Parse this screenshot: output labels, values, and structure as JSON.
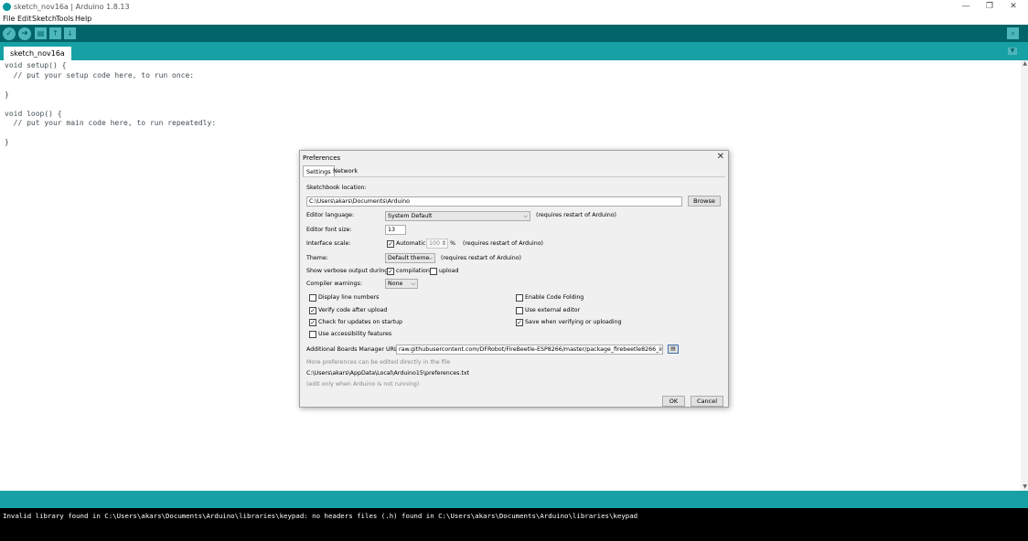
{
  "window": {
    "title": "sketch_nov16a | Arduino 1.8.13",
    "minimize": "—",
    "restore": "❐",
    "close": "✕"
  },
  "menu": [
    "File",
    "Edit",
    "Sketch",
    "Tools",
    "Help"
  ],
  "toolbar": {
    "verify_icon": "✓",
    "upload_icon": "➜",
    "new_icon": "▤",
    "open_icon": "↑",
    "save_icon": "↓",
    "serial_monitor_icon": "⌕"
  },
  "tab": {
    "name": "sketch_nov16a",
    "menu_icon": "▼"
  },
  "code": [
    "void setup() {",
    "  // put your setup code here, to run once:",
    "",
    "}",
    "",
    "void loop() {",
    "  // put your main code here, to run repeatedly:",
    "",
    "}"
  ],
  "scrollbar": {
    "up": "▲",
    "down": "▼"
  },
  "console": {
    "message": "Invalid library found in C:\\Users\\akars\\Documents\\Arduino\\libraries\\keypad: no headers files (.h) found in C:\\Users\\akars\\Documents\\Arduino\\libraries\\keypad"
  },
  "preferences": {
    "title": "Preferences",
    "close": "✕",
    "tabs": [
      "Settings",
      "Network"
    ],
    "sketchbook_label": "Sketchbook location:",
    "sketchbook_path": "C:\\Users\\akars\\Documents\\Arduino",
    "browse": "Browse",
    "editor_language_label": "Editor language:",
    "editor_language_value": "System Default",
    "editor_language_note": "(requires restart of Arduino)",
    "font_size_label": "Editor font size:",
    "font_size_value": "13",
    "interface_scale_label": "Interface scale:",
    "interface_scale_auto": "Automatic",
    "interface_scale_value": "100",
    "interface_scale_unit": "%",
    "interface_scale_note": "(requires restart of Arduino)",
    "theme_label": "Theme:",
    "theme_value": "Default theme",
    "theme_note": "(requires restart of Arduino)",
    "verbose_label": "Show verbose output during:",
    "verbose_compilation": "compilation",
    "verbose_upload": "upload",
    "warnings_label": "Compiler warnings:",
    "warnings_value": "None",
    "checkboxes_left": [
      {
        "label": "Display line numbers",
        "checked": false
      },
      {
        "label": "Verify code after upload",
        "checked": true
      },
      {
        "label": "Check for updates on startup",
        "checked": true
      },
      {
        "label": "Use accessibility features",
        "checked": false
      }
    ],
    "checkboxes_right": [
      {
        "label": "Enable Code Folding",
        "checked": false
      },
      {
        "label": "Use external editor",
        "checked": false
      },
      {
        "label": "Save when verifying or uploading",
        "checked": true
      }
    ],
    "boards_label": "Additional Boards Manager URLs:",
    "boards_url": "raw.githubusercontent.com/DFRobot/FireBeetle-ESP8266/master/package_firebeetle8266_index.json",
    "more_prefs_note": "More preferences can be edited directly in the file",
    "prefs_path": "C:\\Users\\akars\\AppData\\Local\\Arduino15\\preferences.txt",
    "edit_note": "(edit only when Arduino is not running)",
    "ok": "OK",
    "cancel": "Cancel",
    "check_glyph": "✓",
    "caret_glyph": "⌵",
    "spin_glyph": "⇕",
    "urls_btn_glyph": "▤"
  }
}
